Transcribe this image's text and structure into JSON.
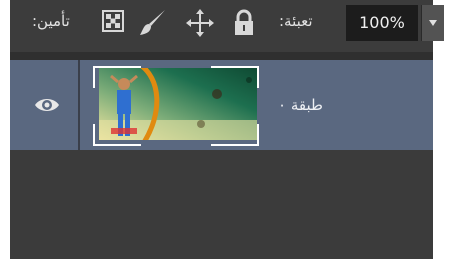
{
  "toolbar": {
    "lock_label": "تأمين:",
    "fill_label": "تعبئة:",
    "fill_value": "100%",
    "icons": [
      "lock-transparent-pixels-icon",
      "lock-image-pixels-icon",
      "lock-position-icon",
      "lock-all-icon",
      "fill-dropdown-icon"
    ]
  },
  "layers": [
    {
      "name": "طبقة ٠",
      "visible": true,
      "selected": true,
      "thumbnail": "layer-thumbnail-image"
    }
  ],
  "colors": {
    "panel_bg": "#3b3b3b",
    "selected_row": "#5a6880",
    "input_bg": "#1c1c1c"
  }
}
